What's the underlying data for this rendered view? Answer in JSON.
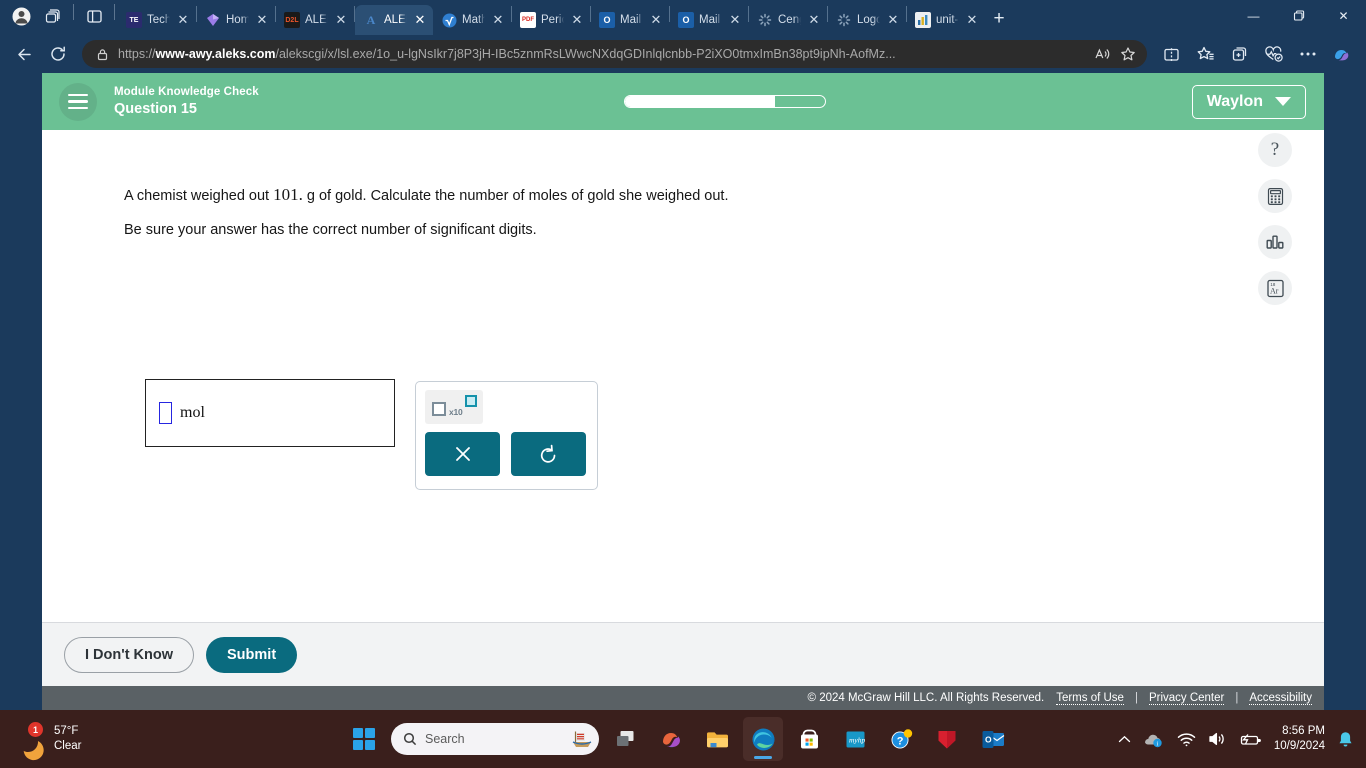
{
  "browser": {
    "tabs": [
      {
        "title": "Tech|E",
        "favicon": "university-icon",
        "active": false
      },
      {
        "title": "Home",
        "favicon": "gem-icon",
        "active": false
      },
      {
        "title": "ALEKS",
        "favicon": "d2l-icon",
        "active": false
      },
      {
        "title": "ALEKS",
        "favicon": "aleks-icon",
        "active": true
      },
      {
        "title": "MathC",
        "favicon": "radical-icon",
        "active": false
      },
      {
        "title": "Period",
        "favicon": "pdf-icon",
        "active": false
      },
      {
        "title": "Mail -",
        "favicon": "outlook-icon",
        "active": false
      },
      {
        "title": "Mail -",
        "favicon": "outlook-icon",
        "active": false
      },
      {
        "title": "Cenga",
        "favicon": "loading-icon",
        "active": false
      },
      {
        "title": "Logou",
        "favicon": "loading-icon",
        "active": false
      },
      {
        "title": "unit-c",
        "favicon": "chart-icon",
        "active": false
      }
    ],
    "new_tab_label": "+",
    "close_label": "✕",
    "url_prefix": "https://",
    "url_domain": "www-awy.aleks.com",
    "url_path": "/alekscgi/x/lsl.exe/1o_u-lgNsIkr7j8P3jH-IBc5znmRsLWwcNXdqGDInlqlcnbb-P2iXO0tmxImBn38pt9ipNh-AofMz...",
    "window_minimize": "—",
    "window_restore": "❐",
    "window_close": "✕"
  },
  "aleks": {
    "header": {
      "subtitle": "Module Knowledge Check",
      "title": "Question 15",
      "progress_percent": 75,
      "user_name": "Waylon"
    },
    "question": {
      "line1_a": "A chemist weighed out ",
      "line1_value": "101.",
      "line1_b": " g of gold. Calculate the number of moles of gold she weighed out.",
      "line2": "Be sure your answer has the correct number of significant digits."
    },
    "answer": {
      "value": "",
      "unit": "mol"
    },
    "toolbar": {
      "scientific_notation_label": "x10",
      "clear_label": "✕",
      "undo_label": "↺"
    },
    "sidebar_tools": [
      {
        "name": "help-icon",
        "glyph": "?"
      },
      {
        "name": "calculator-icon",
        "glyph": ""
      },
      {
        "name": "bar-chart-icon",
        "glyph": ""
      },
      {
        "name": "periodic-table-icon",
        "glyph": "Ar"
      }
    ],
    "actions": {
      "dont_know_label": "I Don't Know",
      "submit_label": "Submit"
    },
    "footer": {
      "copyright": "© 2024 McGraw Hill LLC. All Rights Reserved.",
      "terms": "Terms of Use",
      "privacy": "Privacy Center",
      "accessibility": "Accessibility",
      "separator": "|"
    }
  },
  "taskbar": {
    "weather": {
      "temperature": "57°F",
      "condition": "Clear",
      "badge_count": "1"
    },
    "search_placeholder": "Search",
    "apps": [
      {
        "name": "task-view-icon"
      },
      {
        "name": "copilot-icon"
      },
      {
        "name": "file-explorer-icon"
      },
      {
        "name": "edge-icon"
      },
      {
        "name": "microsoft-store-icon"
      },
      {
        "name": "myhp-icon"
      },
      {
        "name": "help-app-icon"
      },
      {
        "name": "mcafee-icon"
      },
      {
        "name": "outlook-app-icon"
      }
    ],
    "tray": {
      "time": "8:56 PM",
      "date": "10/9/2024"
    }
  },
  "colors": {
    "aleks_green": "#6bc194",
    "teal": "#0a6b7f",
    "browser_chrome": "#1b3a5c",
    "taskbar": "#3a1f1c"
  }
}
